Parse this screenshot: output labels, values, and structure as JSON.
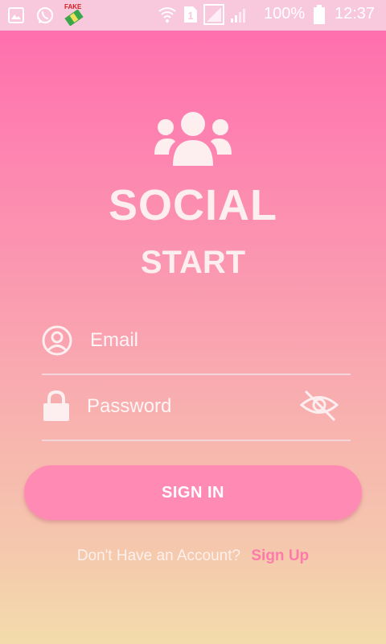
{
  "status_bar": {
    "battery": "100%",
    "time": "12:37",
    "icons": [
      "gallery-icon",
      "whatsapp-icon",
      "fake-gps-icon",
      "wifi-icon",
      "sim-icon",
      "no-signal-icon",
      "signal-icon",
      "battery-icon"
    ],
    "fake_label": "FAKE"
  },
  "brand": {
    "title": "SOCIAL",
    "subtitle": "START",
    "icon": "group-icon"
  },
  "form": {
    "email_placeholder": "Email",
    "password_placeholder": "Password",
    "email_icon": "user-circle-icon",
    "password_icon": "lock-icon",
    "visibility_icon": "eye-off-icon",
    "signin_label": "SIGN IN"
  },
  "footer": {
    "prompt": "Don't Have an Account?",
    "signup_label": "Sign Up"
  },
  "colors": {
    "accent": "#ff7aab",
    "button": "#ff8ab3",
    "gradient_top": "#ff6aad",
    "gradient_bottom": "#f3dcab"
  }
}
